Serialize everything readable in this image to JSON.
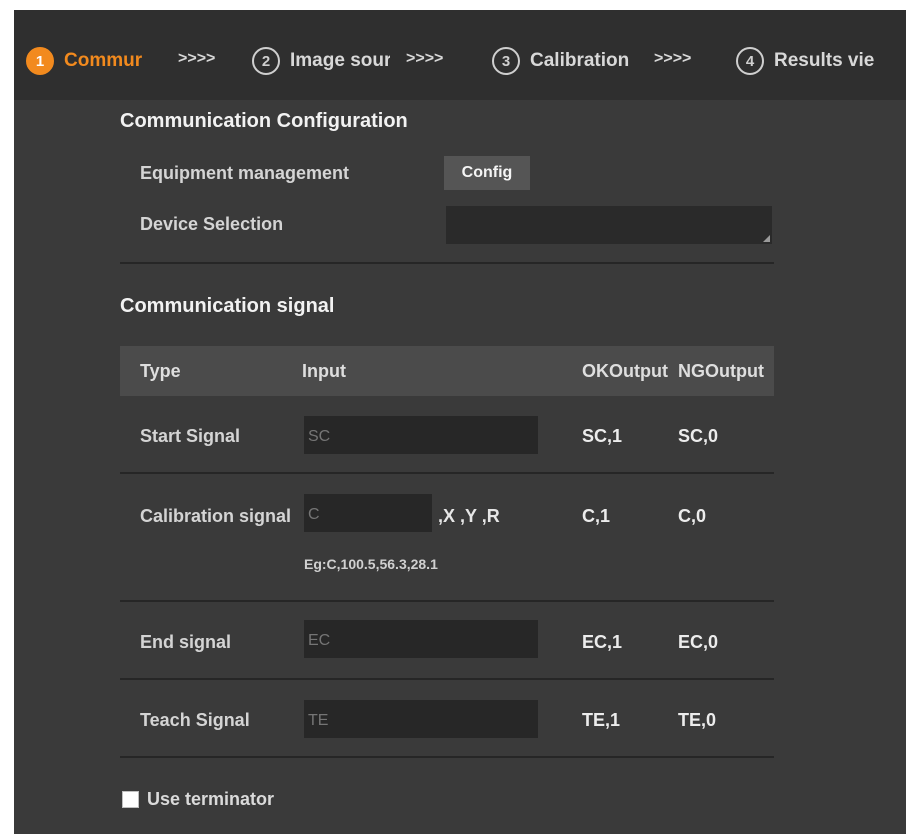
{
  "stepper": {
    "steps": [
      {
        "number": "1",
        "label": "Commur",
        "active": true
      },
      {
        "number": "2",
        "label": "Image sour"
      },
      {
        "number": "3",
        "label": "Calibration"
      },
      {
        "number": "4",
        "label": "Results vie"
      }
    ],
    "separator": ">>>>",
    "accent_color": "#f28a1e"
  },
  "config_section": {
    "title": "Communication Configuration",
    "equipment_label": "Equipment management",
    "config_button": "Config",
    "device_label": "Device Selection",
    "device_value": ""
  },
  "signal_section": {
    "title": "Communication signal",
    "columns": [
      "Type",
      "Input",
      "OKOutput",
      "NGOutput"
    ],
    "rows": [
      {
        "type": "Start Signal",
        "input": "SC",
        "ok": "SC,1",
        "ng": "SC,0"
      },
      {
        "type": "Calibration signal",
        "input": "C",
        "suffix": ",X ,Y ,R",
        "hint": "Eg:C,100.5,56.3,28.1",
        "ok": "C,1",
        "ng": "C,0"
      },
      {
        "type": "End signal",
        "input": "EC",
        "ok": "EC,1",
        "ng": "EC,0"
      },
      {
        "type": "Teach Signal",
        "input": "TE",
        "ok": "TE,1",
        "ng": "TE,0"
      }
    ]
  },
  "terminator": {
    "label": "Use terminator",
    "checked": false
  }
}
